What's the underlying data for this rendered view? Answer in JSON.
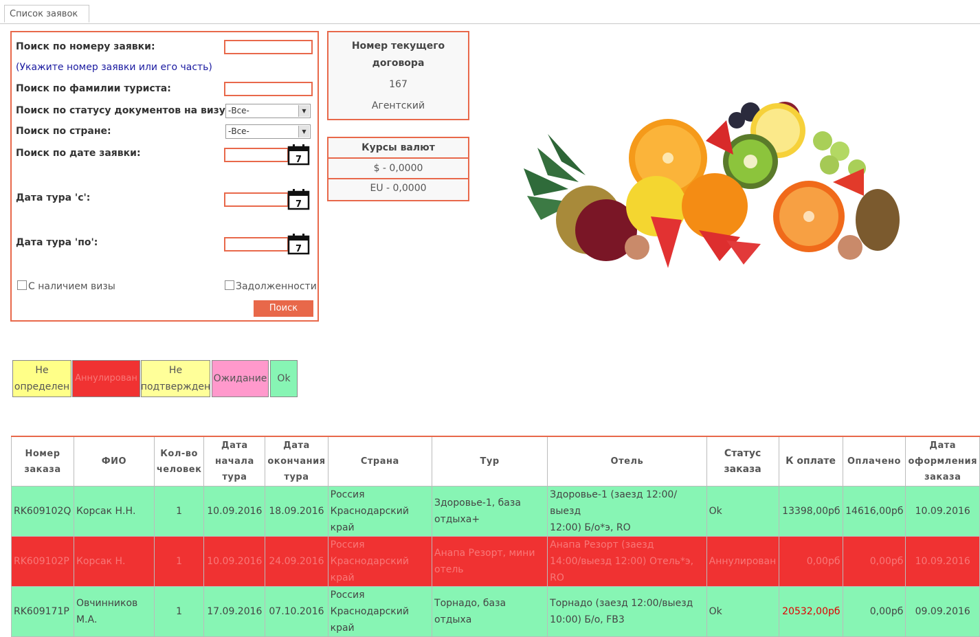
{
  "tab": {
    "label": "Список заявок"
  },
  "search": {
    "order_number_label": "Поиск по номеру заявки:",
    "order_number_hint": "(Укажите номер заявки или его часть)",
    "surname_label": "Поиск по фамилии туриста:",
    "visa_status_label": "Поиск по статусу документов на визу:",
    "visa_status_value": "-Все-",
    "country_label": "Поиск по стране:",
    "country_value": "-Все-",
    "order_date_label": "Поиск по дате заявки:",
    "tour_from_label": "Дата тура 'с':",
    "tour_to_label": "Дата тура 'по':",
    "calendar_day": "7",
    "with_visa_label": "С наличием визы",
    "debts_label": "Задолженности",
    "search_button": "Поиск"
  },
  "contract": {
    "title_line1": "Номер текущего",
    "title_line2": "договора",
    "number": "167",
    "type": "Агентский"
  },
  "rates": {
    "title": "Курсы валют",
    "usd": "$ - 0,0000",
    "eur": "EU - 0,0000"
  },
  "legend": {
    "undefined_1": "Не",
    "undefined_2": "определен",
    "annulled": "Аннулирован",
    "unconfirmed_1": "Не",
    "unconfirmed_2": "подтвержден",
    "waiting": "Ожидание",
    "ok": "Ok"
  },
  "colors": {
    "accent": "#e8684a",
    "undefined": "#ffff88",
    "annulled": "#f03232",
    "unconfirmed": "#ffff99",
    "waiting": "#ff99cc",
    "ok": "#87f5b4",
    "overdue_amount": "#e00000"
  },
  "table": {
    "headers": {
      "number_1": "Номер",
      "number_2": "заказа",
      "fio": "ФИО",
      "people_1": "Кол-во",
      "people_2": "человек",
      "start_1": "Дата",
      "start_2": "начала",
      "start_3": "тура",
      "end_1": "Дата",
      "end_2": "окончания",
      "end_3": "тура",
      "country": "Страна",
      "tour": "Тур",
      "hotel": "Отель",
      "status_1": "Статус",
      "status_2": "заказа",
      "to_pay": "К оплате",
      "paid": "Оплачено",
      "created_1": "Дата",
      "created_2": "оформления",
      "created_3": "заказа"
    },
    "rows": [
      {
        "number": "RK609102Q",
        "fio": "Корсак Н.Н.",
        "people": "1",
        "start": "10.09.2016",
        "end": "18.09.2016",
        "country_1": "Россия",
        "country_2": "Краснодарский край",
        "tour_1": "Здоровье-1, база",
        "tour_2": "отдыха+",
        "hotel_1": "Здоровье-1 (заезд 12:00/ выезд",
        "hotel_2": "12:00) Б/о*э, RO",
        "status": "Ok",
        "to_pay": "13398,00рб",
        "paid": "14616,00рб",
        "created": "10.09.2016"
      },
      {
        "number": "RK609102P",
        "fio": "Корсак Н.",
        "people": "1",
        "start": "10.09.2016",
        "end": "24.09.2016",
        "country_1": "Россия",
        "country_2": "Краснодарский край",
        "tour_1": "Анапа Резорт, мини",
        "tour_2": "отель",
        "hotel_1": "Анапа Резорт (заезд",
        "hotel_2": "14:00/выезд 12:00) Отель*э, RO",
        "status": "Аннулирован",
        "to_pay": "0,00рб",
        "paid": "0,00рб",
        "created": "10.09.2016"
      },
      {
        "number": "RK609171P",
        "fio_1": "Овчинников",
        "fio_2": "М.А.",
        "people": "1",
        "start": "17.09.2016",
        "end": "07.10.2016",
        "country_1": "Россия",
        "country_2": "Краснодарский край",
        "tour": "Торнадо, база отдыха",
        "hotel_1": "Торнадо (заезд 12:00/выезд",
        "hotel_2": "10:00) Б/о, FB3",
        "status": "Ok",
        "to_pay": "20532,00рб",
        "paid": "0,00рб",
        "created": "09.09.2016"
      }
    ]
  }
}
